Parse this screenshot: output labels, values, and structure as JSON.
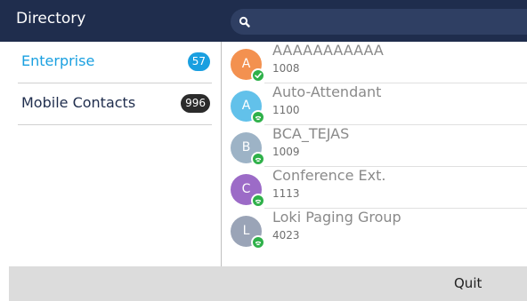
{
  "header": {
    "title": "Directory",
    "search": {
      "placeholder": "",
      "icon": "search-icon"
    }
  },
  "categories": [
    {
      "label": "Enterprise",
      "count": "57",
      "selected": true,
      "label_color": "#1aa0e0",
      "badge_color": "#1a9fe0"
    },
    {
      "label": "Mobile Contacts",
      "count": "996",
      "selected": false,
      "label_color": "#1f2d4d",
      "badge_color": "#2b2b2b"
    }
  ],
  "contacts": [
    {
      "initial": "A",
      "name": "AAAAAAAAAAA",
      "number": "1008",
      "avatar_color": "#f39150",
      "status_icon": "check-icon"
    },
    {
      "initial": "A",
      "name": "Auto-Attendant",
      "number": "1100",
      "avatar_color": "#62c1ea",
      "status_icon": "phone-icon"
    },
    {
      "initial": "B",
      "name": "BCA_TEJAS",
      "number": "1009",
      "avatar_color": "#9db3c6",
      "status_icon": "phone-icon"
    },
    {
      "initial": "C",
      "name": "Conference Ext.",
      "number": "1113",
      "avatar_color": "#9c6bc7",
      "status_icon": "phone-icon"
    },
    {
      "initial": "L",
      "name": "Loki Paging Group",
      "number": "4023",
      "avatar_color": "#9aa4b7",
      "status_icon": "phone-icon"
    }
  ],
  "softkeys": {
    "quit": "Quit"
  }
}
